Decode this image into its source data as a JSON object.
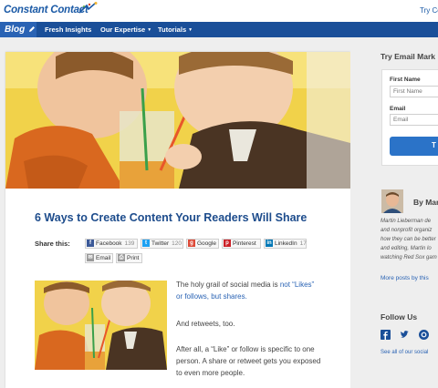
{
  "header": {
    "logo_text": "Constant Contact",
    "try_link": "Try Co"
  },
  "nav": {
    "blog": "Blog",
    "items": [
      "Fresh Insights",
      "Our Expertise",
      "Tutorials"
    ]
  },
  "article": {
    "title": "6 Ways to Create Content Your Readers Will Share",
    "share_label": "Share this:",
    "share_buttons": [
      {
        "label": "Facebook",
        "count": "139",
        "icon": "facebook-icon",
        "color": "#3b5998"
      },
      {
        "label": "Twitter",
        "count": "120",
        "icon": "twitter-icon",
        "color": "#1da1f2"
      },
      {
        "label": "Google",
        "count": "",
        "icon": "google-icon",
        "color": "#dd4b39"
      },
      {
        "label": "Pinterest",
        "count": "",
        "icon": "pinterest-icon",
        "color": "#cb2027"
      },
      {
        "label": "LinkedIn",
        "count": "17",
        "icon": "linkedin-icon",
        "color": "#0077b5"
      },
      {
        "label": "Email",
        "count": "",
        "icon": "email-icon",
        "color": "#888888"
      },
      {
        "label": "Print",
        "count": "",
        "icon": "print-icon",
        "color": "#888888"
      }
    ],
    "para1_a": "The holy grail of social media is ",
    "para1_link": "not “Likes” or follows, but shares.",
    "para2": "And retweets, too.",
    "para3": "After all, a “Like” or follow is specific to one person. A share or retweet gets you exposed to even more people."
  },
  "sidebar": {
    "form_title": "Try Email Mark",
    "first_name_label": "First Name",
    "first_name_placeholder": "First Name",
    "email_label": "Email",
    "email_placeholder": "Email",
    "submit_label": "T",
    "author_by": "By Mar",
    "author_bio": [
      "Martin Lieberman de",
      "and nonprofit organiz",
      "how they can be better",
      "and editing, Martin lo",
      "watching Red Sox gam"
    ],
    "more_posts": "More posts by this",
    "follow_title": "Follow Us",
    "see_all": "See all of our social"
  },
  "colors": {
    "brand_blue": "#1a4f99",
    "link_blue": "#2a63b4",
    "title_blue": "#1d4c8c",
    "button_blue": "#2b73c8"
  }
}
